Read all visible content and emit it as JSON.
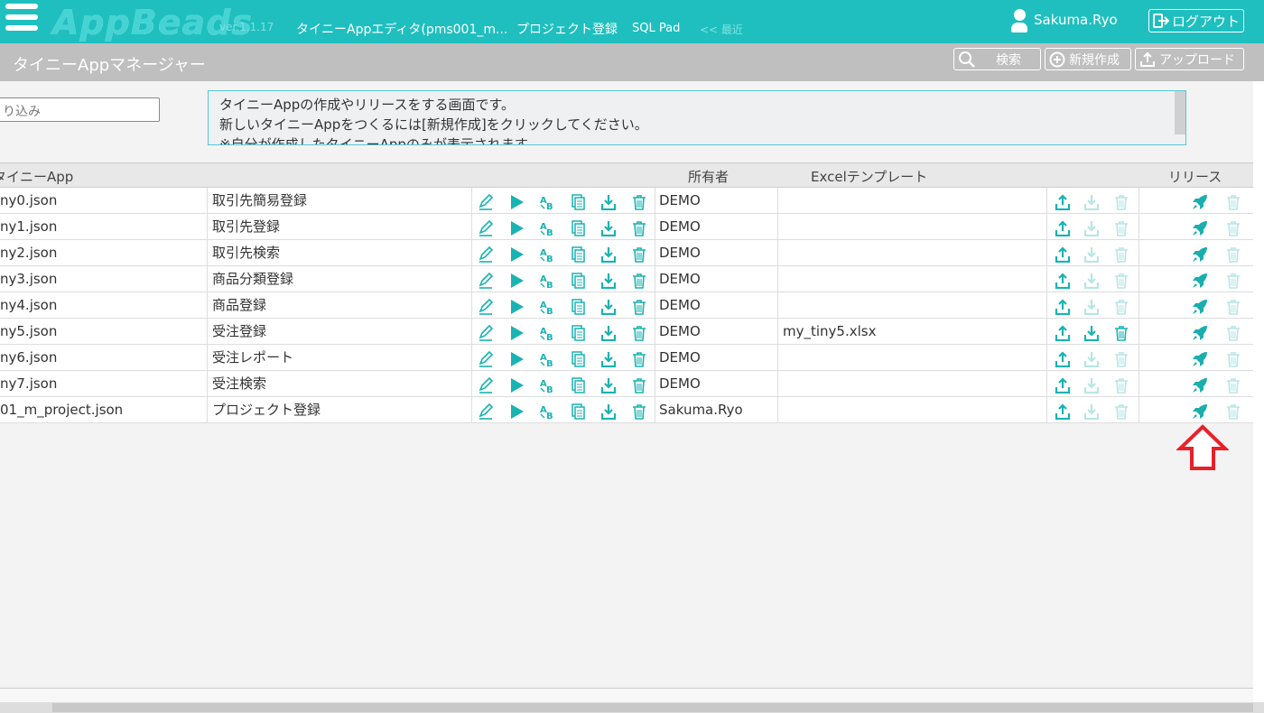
{
  "header": {
    "logo": "AppBeads",
    "version": "ver.1.1.17",
    "nav": [
      "タイニーAppエディタ(pms001_m...",
      "プロジェクト登録",
      "SQL Pad"
    ],
    "recent": "<< 最近",
    "user": "Sakuma.Ryo",
    "logout": "ログアウト"
  },
  "toolbar": {
    "title": "タイニーAppマネージャー",
    "search": "検索",
    "create": "新規作成",
    "upload": "アップロード"
  },
  "filter": {
    "placeholder": "り込み"
  },
  "info": {
    "lines": [
      "タイニーAppの作成やリリースをする画面です。",
      "新しいタイニーAppをつくるには[新規作成]をクリックしてください。",
      "※自分が作成したタイニーAppのみが表示されます。"
    ]
  },
  "grid": {
    "headers": {
      "app": "タイニーApp",
      "owner": "所有者",
      "template": "Excelテンプレート",
      "release": "リリース"
    },
    "rows": [
      {
        "file": "ny0.json",
        "name": "取引先簡易登録",
        "owner": "DEMO",
        "template": ""
      },
      {
        "file": "ny1.json",
        "name": "取引先登録",
        "owner": "DEMO",
        "template": ""
      },
      {
        "file": "ny2.json",
        "name": "取引先検索",
        "owner": "DEMO",
        "template": ""
      },
      {
        "file": "ny3.json",
        "name": "商品分類登録",
        "owner": "DEMO",
        "template": ""
      },
      {
        "file": "ny4.json",
        "name": "商品登録",
        "owner": "DEMO",
        "template": ""
      },
      {
        "file": "ny5.json",
        "name": "受注登録",
        "owner": "DEMO",
        "template": "my_tiny5.xlsx"
      },
      {
        "file": "ny6.json",
        "name": "受注レポート",
        "owner": "DEMO",
        "template": ""
      },
      {
        "file": "ny7.json",
        "name": "受注検索",
        "owner": "DEMO",
        "template": ""
      },
      {
        "file": "01_m_project.json",
        "name": "プロジェクト登録",
        "owner": "Sakuma.Ryo",
        "template": ""
      }
    ]
  },
  "colors": {
    "accent": "#1fbfbf",
    "icon": "#19b3b3",
    "disabled": "#b6e6e6",
    "highlight": "#e8202a"
  }
}
